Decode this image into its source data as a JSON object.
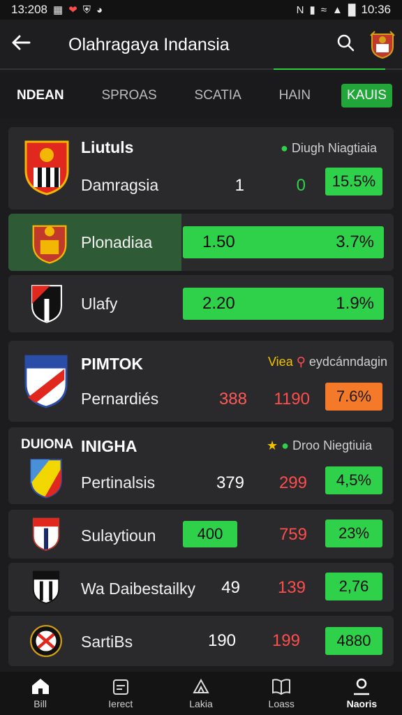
{
  "status_bar": {
    "time_left": "13:208",
    "time_right": "10:36"
  },
  "header": {
    "title": "Olahragaya Indansia"
  },
  "tabs": [
    {
      "label": "NDEAN"
    },
    {
      "label": "SPROAS"
    },
    {
      "label": "SCATIA"
    },
    {
      "label": "HAIN"
    },
    {
      "label": "KAUIS"
    }
  ],
  "group1": {
    "title": "Liutuls",
    "meta": "Diugh Niagtiaia",
    "rows": [
      {
        "team": "Damragsia",
        "a": "1",
        "b": "0",
        "pct": "15.5%"
      },
      {
        "team": "Plonadiaa",
        "a": "1.50",
        "pct": "3.7%"
      },
      {
        "team": "Ulafy",
        "a": "2.20",
        "pct": "1.9%"
      }
    ]
  },
  "group2": {
    "title": "PIMTOK",
    "meta_a": "Viea",
    "meta_b": "eydcánndagin",
    "rows": [
      {
        "team": "Pernardiés",
        "a": "388",
        "b": "1190",
        "pct": "7.6%"
      }
    ]
  },
  "group3": {
    "title_a": "DUIONA",
    "title_b": "INIGHA",
    "meta": "Droo Niegtiuia",
    "rows": [
      {
        "team": "Pertinalsis",
        "a": "379",
        "b": "299",
        "pct": "4,5%"
      },
      {
        "team": "Sulaytioun",
        "a": "400",
        "b": "759",
        "pct": "23%"
      },
      {
        "team": "Wa Daibestailky",
        "a": "49",
        "b": "139",
        "pct": "2,76"
      },
      {
        "team": "SartiBs",
        "a": "190",
        "b": "199",
        "pct": "4880"
      }
    ]
  },
  "bottom_nav": [
    {
      "label": "Bill"
    },
    {
      "label": "Ierect"
    },
    {
      "label": "Lakia"
    },
    {
      "label": "Loass"
    },
    {
      "label": "Naoris"
    }
  ],
  "colors": {
    "green": "#2fd14a",
    "red": "#ff4d4d",
    "orange": "#f47a2a",
    "tab_active": "#22a63a"
  }
}
